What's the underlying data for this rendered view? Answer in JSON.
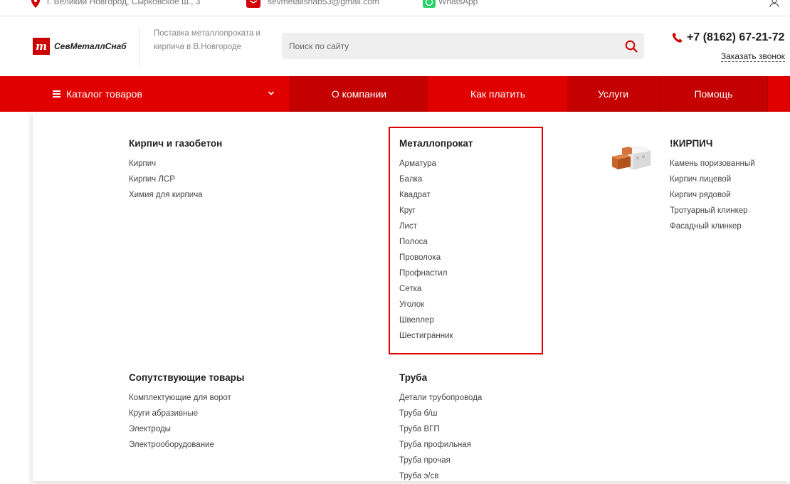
{
  "topbar": {
    "address": "г. Великий Новгород, Сырковское ш., 3",
    "email": "sevmetallsnab53@gmail.com",
    "whatsapp": "WhatsApp"
  },
  "header": {
    "logo_text": "СевМеталлСнаб",
    "logo_mark": "m",
    "tagline": "Поставка металлопроката и кирпича в В.Новгороде",
    "search_placeholder": "Поиск по сайту",
    "phone": "+7 (8162) 67-21-72",
    "callback": "Заказать звонок"
  },
  "nav": {
    "catalog": "Каталог товаров",
    "items": [
      "О компании",
      "Как платить",
      "Услуги",
      "Помощь"
    ]
  },
  "menu": {
    "col1": {
      "title": "Кирпич и газобетон",
      "items": [
        "Кирпич",
        "Кирпич ЛСР",
        "Химия для кирпича"
      ]
    },
    "col2": {
      "title": "Металлопрокат",
      "items": [
        "Арматура",
        "Балка",
        "Квадрат",
        "Круг",
        "Лист",
        "Полоса",
        "Проволока",
        "Профнастил",
        "Сетка",
        "Уголок",
        "Швеллер",
        "Шестигранник"
      ]
    },
    "col3": {
      "title": "!КИРПИЧ",
      "items": [
        "Камень поризованный",
        "Кирпич лицевой",
        "Кирпич рядовой",
        "Тротуарный клинкер",
        "Фасадный клинкер"
      ]
    },
    "col4": {
      "title": "Сопутствующие товары",
      "items": [
        "Комплектующие для ворот",
        "Круги абразивные",
        "Электроды",
        "Электрооборудование"
      ]
    },
    "col5": {
      "title": "Труба",
      "items": [
        "Детали трубопровода",
        "Труба б/ш",
        "Труба ВГП",
        "Труба профильная",
        "Труба прочая",
        "Труба э/св"
      ]
    }
  },
  "colors": {
    "brand_red": "#e00000",
    "dark_red": "#c40000"
  },
  "icons": [
    "location-pin-icon",
    "mail-icon",
    "whatsapp-icon",
    "user-icon",
    "search-icon",
    "phone-icon",
    "hamburger-icon",
    "chevron-down-icon",
    "brick-product-image"
  ]
}
